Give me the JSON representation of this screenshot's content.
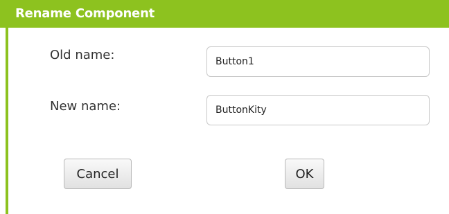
{
  "dialog": {
    "title": "Rename Component",
    "old_name_label": "Old name:",
    "old_name_value": "Button1",
    "new_name_label": "New name:",
    "new_name_value": "ButtonKity",
    "cancel_label": "Cancel",
    "ok_label": "OK"
  },
  "colors": {
    "accent": "#8dc21f"
  }
}
